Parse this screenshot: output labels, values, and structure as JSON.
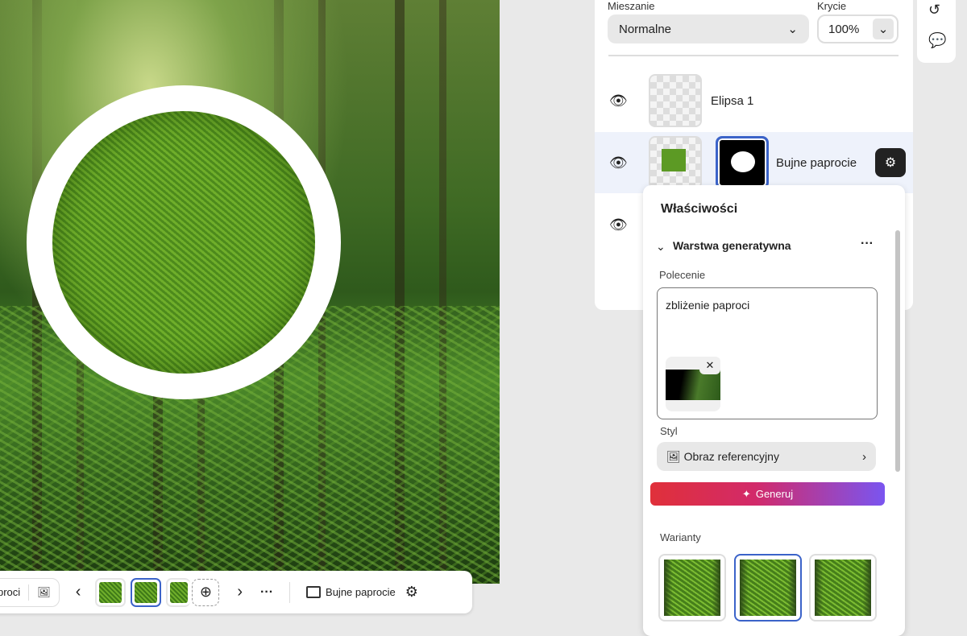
{
  "layers_panel": {
    "blend_label": "Mieszanie",
    "blend_value": "Normalne",
    "opacity_label": "Krycie",
    "opacity_value": "100%",
    "layers": [
      {
        "name": "Elipsa 1"
      },
      {
        "name": "Bujne paprocie"
      }
    ]
  },
  "rail": {
    "history": "history-icon",
    "comments": "comment-icon"
  },
  "properties": {
    "title": "Właściwości",
    "section": "Warstwa generatywna",
    "prompt_label": "Polecenie",
    "prompt_value": "zbliżenie paproci",
    "style_label": "Styl",
    "style_value": "Obraz referencyjny",
    "generate_label": "Generuj",
    "variants_label": "Warianty",
    "variant_selected": 2,
    "colors": {
      "gradient_start": "#e0303a",
      "gradient_end": "#7a55f0",
      "accent": "#3b63c9"
    }
  },
  "bottombar": {
    "prompt_partial": "proci",
    "layer_name": "Bujne paprocie"
  }
}
